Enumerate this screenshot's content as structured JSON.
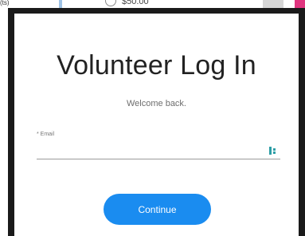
{
  "background": {
    "left_text": "(ts)",
    "price": "$50.00"
  },
  "modal": {
    "title": "Volunteer Log In",
    "subtitle": "Welcome back.",
    "email": {
      "label": "* Email",
      "value": "",
      "icon": "password-manager-icon"
    },
    "continue_label": "Continue"
  },
  "colors": {
    "accent": "#1a8cf0",
    "frame": "#1a1a1a",
    "pink_tab": "#e0357f"
  }
}
